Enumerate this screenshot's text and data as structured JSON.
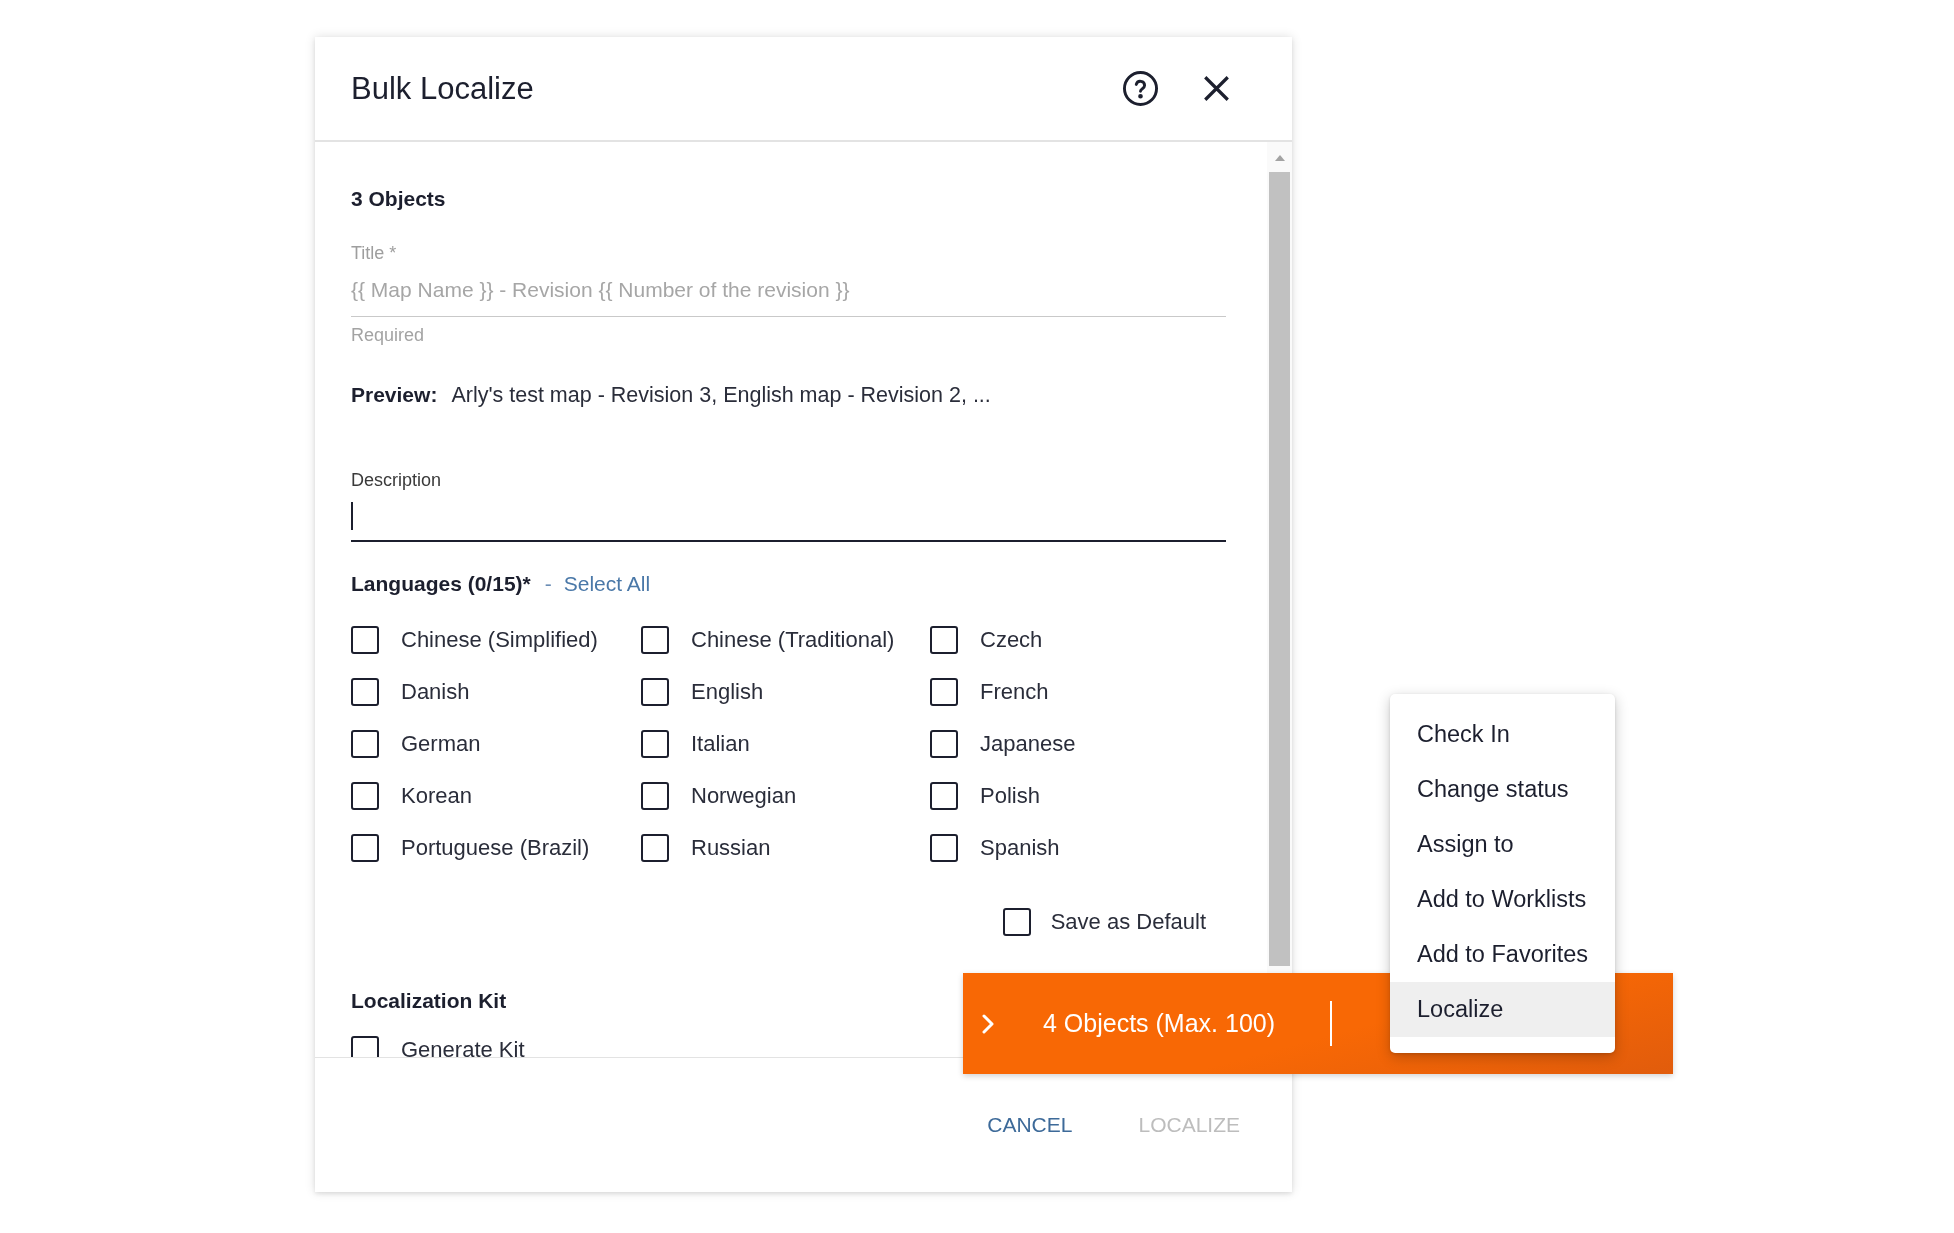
{
  "dialog": {
    "title": "Bulk Localize",
    "object_count": "3 Objects",
    "title_field": {
      "label": "Title *",
      "placeholder": "{{ Map Name }} - Revision {{ Number of the revision }}",
      "helper": "Required"
    },
    "preview": {
      "label": "Preview:",
      "value": "Arly's test map - Revision 3, English map - Revision 2, ..."
    },
    "description_field": {
      "label": "Description",
      "focused": true
    },
    "languages": {
      "heading": "Languages (0/15)*",
      "separator": "-",
      "select_all": "Select All",
      "options": [
        {
          "label": "Chinese (Simplified)",
          "checked": false
        },
        {
          "label": "Chinese (Traditional)",
          "checked": false
        },
        {
          "label": "Czech",
          "checked": false
        },
        {
          "label": "Danish",
          "checked": false
        },
        {
          "label": "English",
          "checked": false
        },
        {
          "label": "French",
          "checked": false
        },
        {
          "label": "German",
          "checked": false
        },
        {
          "label": "Italian",
          "checked": false
        },
        {
          "label": "Japanese",
          "checked": false
        },
        {
          "label": "Korean",
          "checked": false
        },
        {
          "label": "Norwegian",
          "checked": false
        },
        {
          "label": "Polish",
          "checked": false
        },
        {
          "label": "Portuguese (Brazil)",
          "checked": false
        },
        {
          "label": "Russian",
          "checked": false
        },
        {
          "label": "Spanish",
          "checked": false
        }
      ]
    },
    "save_as_default": {
      "label": "Save as Default",
      "checked": false
    },
    "localization_kit": {
      "heading": "Localization Kit",
      "options": [
        {
          "label": "Generate Kit",
          "checked": false
        }
      ]
    },
    "buttons": [
      {
        "label": "CANCEL",
        "disabled": false
      },
      {
        "label": "LOCALIZE",
        "disabled": true
      }
    ]
  },
  "selection_bar": {
    "count": "4 Objects (Max. 100)"
  },
  "context_menu": {
    "items": [
      {
        "label": "Check In",
        "selected": false
      },
      {
        "label": "Change status",
        "selected": false
      },
      {
        "label": "Assign to",
        "selected": false
      },
      {
        "label": "Add to Worklists",
        "selected": false
      },
      {
        "label": "Add to Favorites",
        "selected": false
      },
      {
        "label": "Localize",
        "selected": true
      }
    ]
  }
}
